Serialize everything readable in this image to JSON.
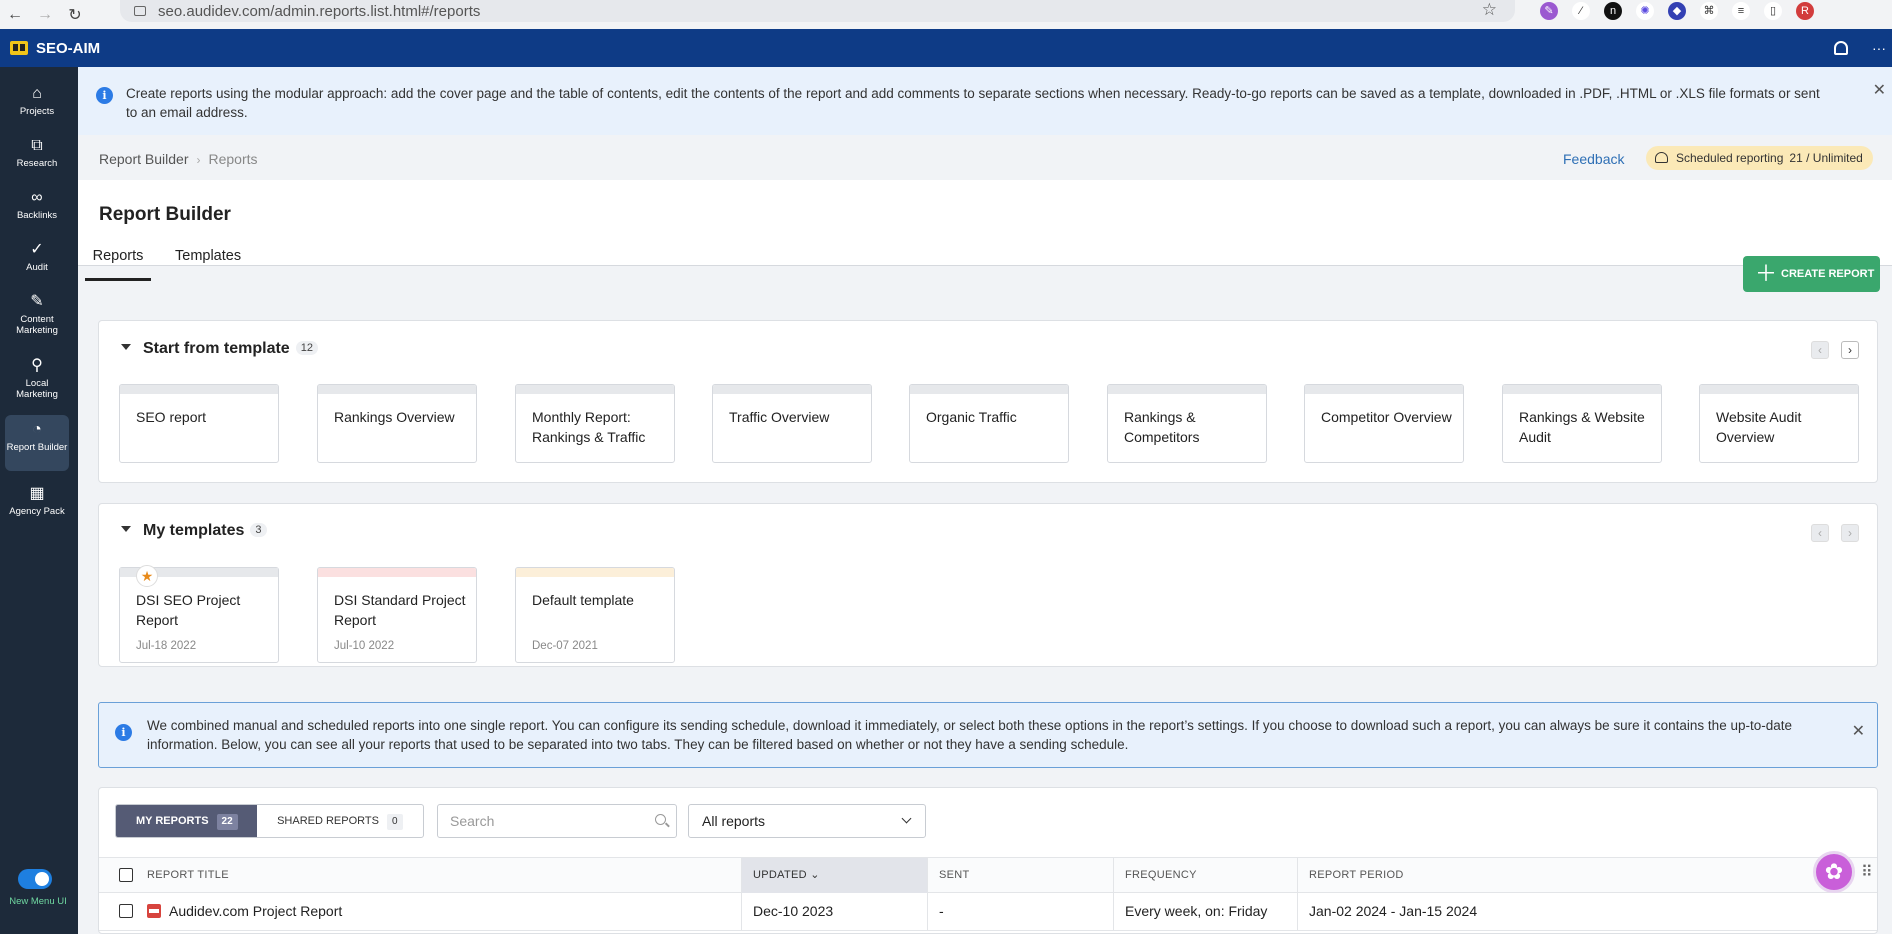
{
  "browser": {
    "url": "seo.audidev.com/admin.reports.list.html#/reports",
    "nav_back": "←",
    "nav_forward": "→",
    "nav_reload": "↻",
    "profile_initial": "R"
  },
  "app": {
    "brand": "SEO-AIM",
    "top_more": "···"
  },
  "sidebar": {
    "items": [
      {
        "label": "Projects",
        "icon": "home-icon",
        "glyph": "⌂"
      },
      {
        "label": "Research",
        "icon": "research-icon",
        "glyph": "⧉"
      },
      {
        "label": "Backlinks",
        "icon": "link-icon",
        "glyph": "∞"
      },
      {
        "label": "Audit",
        "icon": "check-circle-icon",
        "glyph": "✓"
      },
      {
        "label": "Content Marketing",
        "icon": "edit-icon",
        "glyph": "✎"
      },
      {
        "label": "Local Marketing",
        "icon": "location-pin-icon",
        "glyph": "⚲"
      },
      {
        "label": "Report Builder",
        "icon": "pie-chart-icon",
        "glyph": "◔"
      },
      {
        "label": "Agency Pack",
        "icon": "building-icon",
        "glyph": "▦"
      }
    ],
    "toggle_label": "New Menu UI"
  },
  "info_banner": {
    "text": "Create reports using the modular approach: add the cover page and the table of contents, edit the contents of the report and add comments to separate sections when necessary. Ready-to-go reports can be saved as a template, downloaded in .PDF, .HTML or .XLS file formats or sent to an email address."
  },
  "breadcrumb": {
    "items": [
      "Report Builder",
      "Reports"
    ],
    "separator": "›"
  },
  "feedback_label": "Feedback",
  "scheduled": {
    "label": "Scheduled reporting",
    "value": "21 / Unlimited"
  },
  "page": {
    "title": "Report Builder",
    "tabs": [
      "Reports",
      "Templates"
    ],
    "create_label": "CREATE REPORT"
  },
  "start_from_template": {
    "title": "Start from template",
    "count": "12",
    "items": [
      "SEO report",
      "Rankings Overview",
      "Monthly Report: Rankings & Traffic",
      "Traffic Overview",
      "Organic Traffic",
      "Rankings & Competitors",
      "Competitor Overview",
      "Rankings & Website Audit",
      "Website Audit Overview"
    ]
  },
  "my_templates": {
    "title": "My templates",
    "count": "3",
    "items": [
      {
        "name": "DSI SEO Project Report",
        "date": "Jul-18 2022",
        "strip_color": "#e6e8eb",
        "starred": true
      },
      {
        "name": "DSI Standard Project Report",
        "date": "Jul-10 2022",
        "strip_color": "#fbe0e0",
        "starred": false
      },
      {
        "name": "Default template",
        "date": "Dec-07 2021",
        "strip_color": "#fcefd9",
        "starred": false
      }
    ]
  },
  "notice": {
    "text": "We combined manual and scheduled reports into one single report. You can configure its sending schedule, download it immediately, or select both these options in the report’s settings. If you choose to download such a report, you can always be sure it contains the up-to-date information. Below, you can see all your reports that used to be separated into two tabs. They can be filtered based on whether or not they have a sending schedule."
  },
  "reports": {
    "segments": [
      {
        "label": "MY REPORTS",
        "count": "22"
      },
      {
        "label": "SHARED REPORTS",
        "count": "0"
      }
    ],
    "search_placeholder": "Search",
    "filter_value": "All reports",
    "columns": [
      "REPORT TITLE",
      "UPDATED",
      "SENT",
      "FREQUENCY",
      "REPORT PERIOD"
    ],
    "sort_indicator": "⌄",
    "rows": [
      {
        "title": "Audidev.com Project Report",
        "updated": "Dec-10 2023",
        "sent": "-",
        "frequency": "Every week, on: Friday",
        "period": "Jan-02 2024 - Jan-15 2024"
      }
    ]
  },
  "colors": {
    "app_bar": "#0e3b86",
    "sidebar": "#1d2a3a",
    "accent_green": "#3aa76d",
    "info_bg": "#e8f1fc",
    "segment_active": "#555b75"
  }
}
